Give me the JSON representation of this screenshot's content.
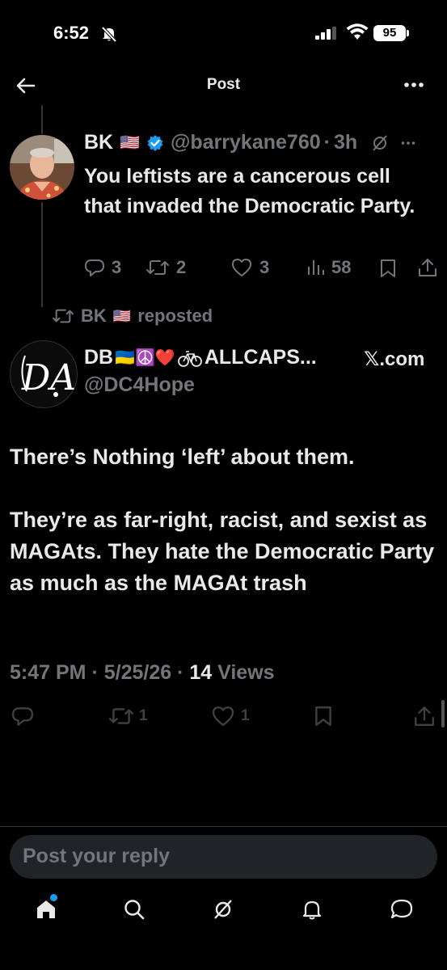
{
  "status_bar": {
    "time": "6:52",
    "battery": "95"
  },
  "header": {
    "title": "Post"
  },
  "parent_post": {
    "name": "BK",
    "flag": "🇺🇸",
    "handle": "@barrykane760",
    "separator": "·",
    "time": "3h",
    "text": "You leftists are a cancerous cell that invaded the Democratic Party.",
    "replies": "3",
    "reposts": "2",
    "likes": "3",
    "views": "58"
  },
  "repost_label": {
    "name": "BK",
    "flag": "🇺🇸",
    "text": "reposted"
  },
  "main_post": {
    "name_prefix": "DB",
    "name_emojis": "🇺🇦☮️❤️",
    "name_suffix": "ALLCAPS...",
    "handle": "@DC4Hope",
    "source": "𝕏.com",
    "avatar_text": "DA",
    "paragraph_1": "There’s Nothing ‘left’ about them.",
    "paragraph_2": "They’re as far-right, racist, and sexist as MAGAts. They hate the Democratic Party as much as the MAGAt trash",
    "time": "5:47 PM",
    "date": "5/25/26",
    "views_count": "14",
    "views_label": "Views",
    "reposts": "1",
    "likes": "1"
  },
  "reply_box": {
    "placeholder": "Post your reply"
  },
  "tab_bar": {
    "items": [
      "home",
      "search",
      "grok",
      "notifications",
      "messages"
    ]
  },
  "colors": {
    "background": "#000000",
    "text": "#e7e9ea",
    "muted": "#71767b",
    "accent": "#1d9bf0",
    "verified": "#1d9bf0"
  }
}
